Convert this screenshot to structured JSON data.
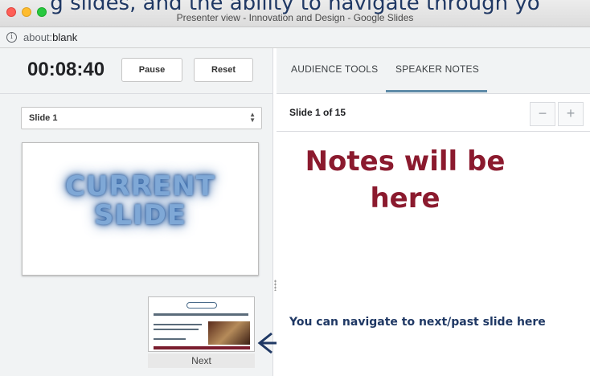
{
  "overlay": {
    "top_caption": "g slides, and the ability to navigate through yo",
    "notes_title": "Notes will be here",
    "nav_caption": "You can navigate to next/past slide here"
  },
  "window": {
    "title": "Presenter view - Innovation and Design - Google Slides"
  },
  "address_bar": {
    "prefix": "about:",
    "host": "blank"
  },
  "presenter": {
    "timer": "00:08:40",
    "pause_label": "Pause",
    "reset_label": "Reset",
    "slide_select": "Slide 1",
    "current_slide_text": "CURRENT SLIDE",
    "next_label": "Next"
  },
  "notes_panel": {
    "tabs": [
      {
        "label": "AUDIENCE TOOLS"
      },
      {
        "label": "SPEAKER NOTES"
      }
    ],
    "slide_counter": "Slide 1 of 15",
    "decrease_label": "−",
    "increase_label": "+"
  },
  "colors": {
    "notes_title": "#8b1a2e",
    "caption_blue": "#1f3864",
    "tab_underline": "#5f8ba8"
  }
}
